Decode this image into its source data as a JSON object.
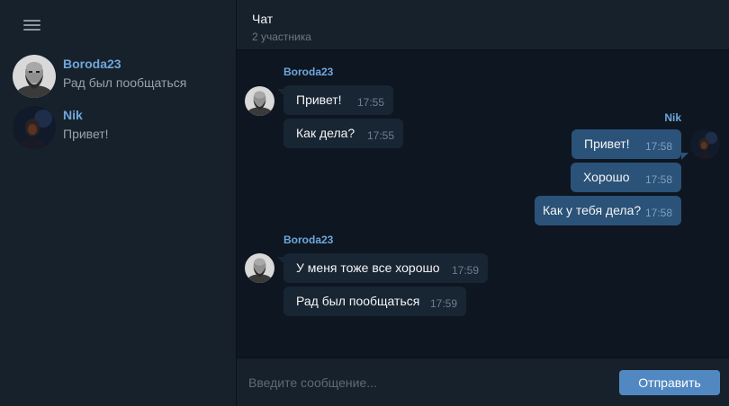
{
  "sidebar": {
    "chats": [
      {
        "name": "Boroda23",
        "preview": "Рад был пообщаться",
        "avatar_icon": "bearded-man-avatar"
      },
      {
        "name": "Nik",
        "preview": "Привет!",
        "avatar_icon": "dark-portrait-avatar"
      }
    ]
  },
  "header": {
    "title": "Чат",
    "subtitle": "2 участника"
  },
  "messages": {
    "groups": [
      {
        "sender": "Boroda23",
        "direction": "incoming",
        "items": [
          {
            "text": "Привет!",
            "time": "17:55"
          },
          {
            "text": "Как дела?",
            "time": "17:55"
          }
        ]
      },
      {
        "sender": "Nik",
        "direction": "outgoing",
        "items": [
          {
            "text": "Привет!",
            "time": "17:58"
          },
          {
            "text": "Хорошо",
            "time": "17:58"
          },
          {
            "text": "Как у тебя дела?",
            "time": "17:58"
          }
        ]
      },
      {
        "sender": "Boroda23",
        "direction": "incoming",
        "items": [
          {
            "text": "У меня тоже все хорошо",
            "time": "17:59"
          },
          {
            "text": "Рад был пообщаться",
            "time": "17:59"
          }
        ]
      }
    ]
  },
  "composer": {
    "placeholder": "Введите сообщение...",
    "value": "",
    "send_label": "Отправить"
  },
  "colors": {
    "background": "#0e1621",
    "panel": "#17212b",
    "incoming_bubble": "#182533",
    "outgoing_bubble": "#2b5278",
    "accent": "#6ea7dc",
    "send_button": "#5288c1"
  }
}
